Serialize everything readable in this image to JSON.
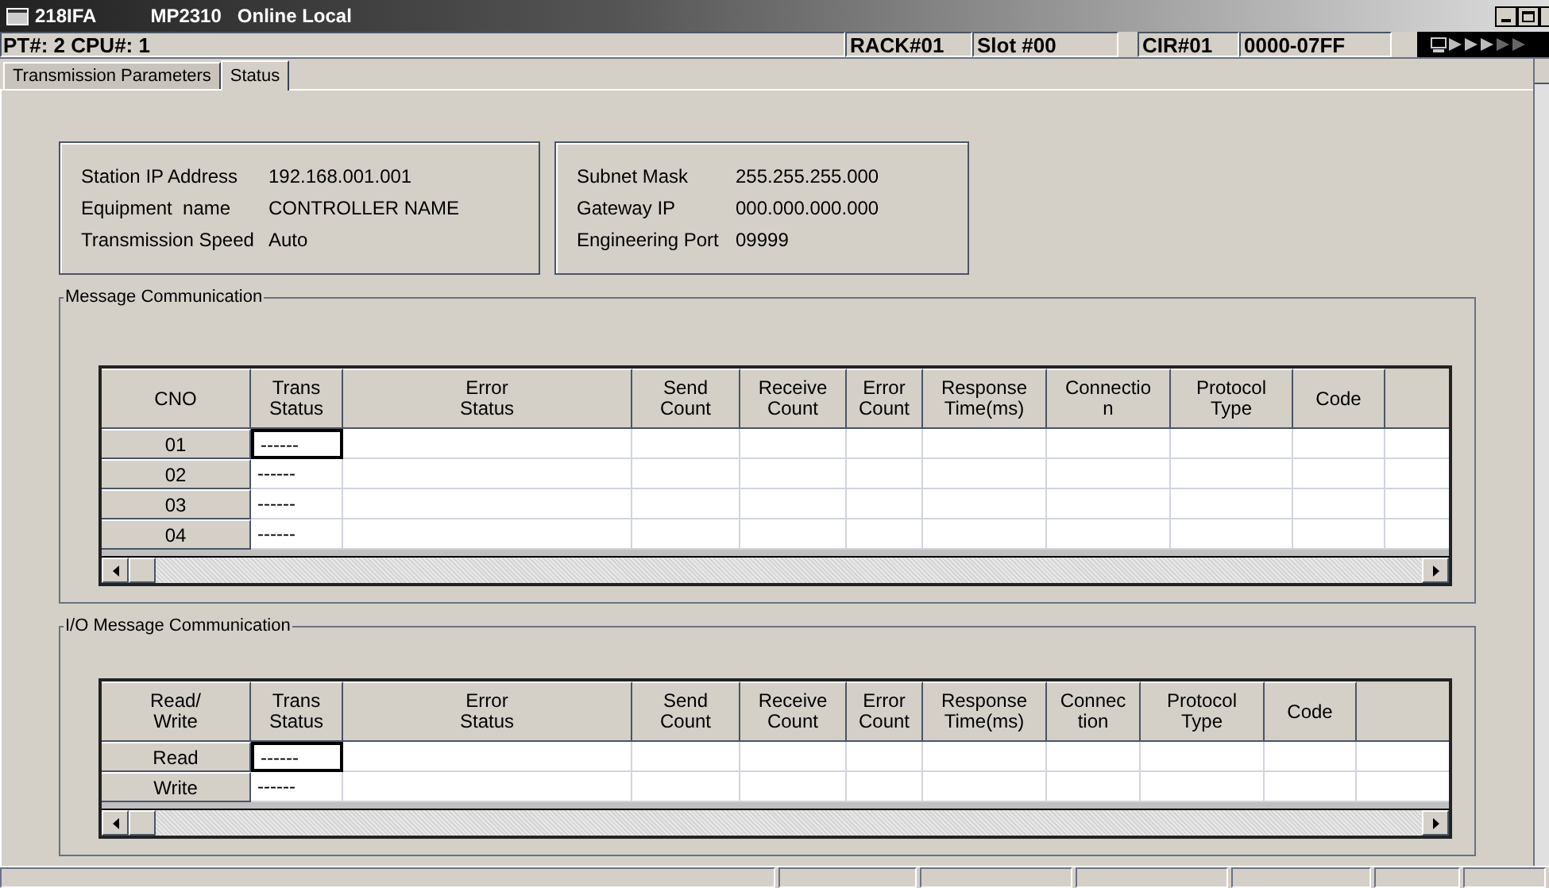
{
  "window": {
    "title": "218IFA",
    "subtitle": "MP2310",
    "mode": "Online Local"
  },
  "info_bar": {
    "cpu": "PT#: 2 CPU#: 1",
    "fields": [
      "RACK#01",
      "Slot #00",
      "CIR#01",
      "0000-07FF"
    ]
  },
  "tabs": [
    {
      "label": "Transmission Parameters",
      "selected": false
    },
    {
      "label": "Status",
      "selected": true
    }
  ],
  "station_box": [
    {
      "label": "Station IP Address",
      "value": "192.168.001.001"
    },
    {
      "label": "Equipment  name",
      "value": "CONTROLLER NAME"
    },
    {
      "label": "Transmission Speed",
      "value": "Auto"
    }
  ],
  "network_box": [
    {
      "label": "Subnet Mask",
      "value": "255.255.255.000"
    },
    {
      "label": "Gateway IP",
      "value": "000.000.000.000"
    },
    {
      "label": "Engineering Port",
      "value": "09999"
    }
  ],
  "sections": [
    {
      "title": "Message Communication",
      "columns": [
        "CNO",
        "Trans\nStatus",
        "Error\nStatus",
        "Send\nCount",
        "Receive\nCount",
        "Error\nCount",
        "Response\nTime(ms)",
        "Connectio\nn",
        "Protocol\nType",
        "Code"
      ],
      "rows": [
        {
          "label": "01",
          "trans_status": "------",
          "selected": true
        },
        {
          "label": "02",
          "trans_status": "------",
          "selected": false
        },
        {
          "label": "03",
          "trans_status": "------",
          "selected": false
        },
        {
          "label": "04",
          "trans_status": "------",
          "selected": false
        }
      ]
    },
    {
      "title": "I/O Message Communication",
      "columns": [
        "Read/\nWrite",
        "Trans\nStatus",
        "Error\nStatus",
        "Send\nCount",
        "Receive\nCount",
        "Error\nCount",
        "Response\nTime(ms)",
        "Connec\ntion",
        "Protocol\nType",
        "Code"
      ],
      "rows": [
        {
          "label": "Read",
          "trans_status": "------",
          "selected": true
        },
        {
          "label": "Write",
          "trans_status": "------",
          "selected": false
        }
      ]
    }
  ]
}
